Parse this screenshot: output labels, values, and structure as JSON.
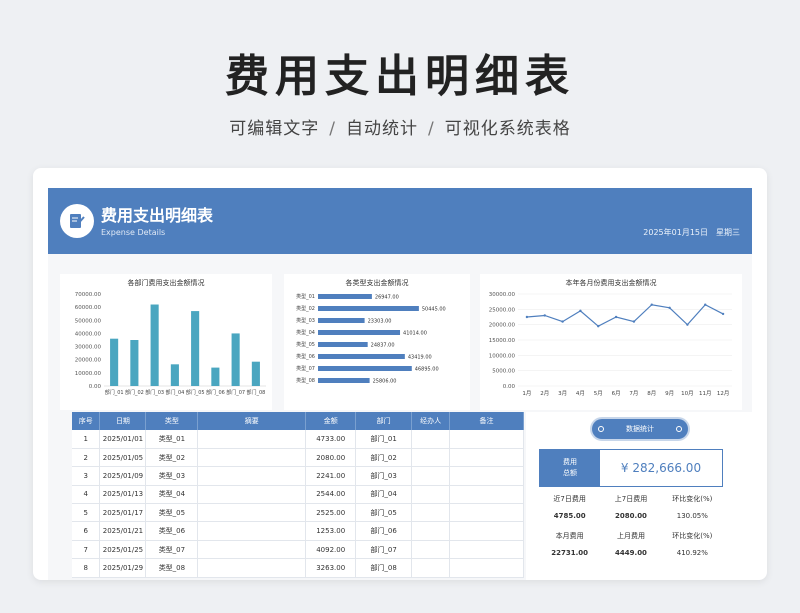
{
  "hero": {
    "title": "费用支出明细表",
    "sub1": "可编辑文字",
    "sub2": "自动统计",
    "sub3": "可视化系统表格",
    "sep": "/"
  },
  "banner": {
    "title": "费用支出明细表",
    "subtitle": "Expense Details",
    "date": "2025年01月15日",
    "weekday": "星期三"
  },
  "colors": {
    "accent": "#4f7fbe",
    "bar1": "#4aa6c0",
    "bar2": "#4f7fbe"
  },
  "charts": [
    {
      "type": "bar",
      "title": "各部门费用支出金额情况",
      "categories": [
        "部门_01",
        "部门_02",
        "部门_03",
        "部门_04",
        "部门_05",
        "部门_06",
        "部门_07",
        "部门_08"
      ],
      "values": [
        36000,
        35000,
        62000,
        16500,
        57000,
        14000,
        40000,
        18500
      ],
      "ylim": [
        0,
        70000
      ],
      "yticks": [
        "70000.00",
        "60000.00",
        "50000.00",
        "40000.00",
        "30000.00",
        "20000.00",
        "10000.00",
        "0.00"
      ]
    },
    {
      "type": "bar-horizontal",
      "title": "各类型支出金额情况",
      "categories": [
        "类型_01",
        "类型_02",
        "类型_03",
        "类型_04",
        "类型_05",
        "类型_06",
        "类型_07",
        "类型_08"
      ],
      "values": [
        26947.0,
        50445.0,
        23303.0,
        41014.0,
        24837.0,
        43419.0,
        46895.0,
        25806.0
      ],
      "labels": [
        "26947.00",
        "50445.00",
        "23303.00",
        "41014.00",
        "24837.00",
        "43419.00",
        "46895.00",
        "25806.00"
      ],
      "xlim": [
        0,
        60000
      ]
    },
    {
      "type": "line",
      "title": "本年各月份费用支出金额情况",
      "categories": [
        "1月",
        "2月",
        "3月",
        "4月",
        "5月",
        "6月",
        "7月",
        "8月",
        "9月",
        "10月",
        "11月",
        "12月"
      ],
      "values": [
        22500,
        23000,
        21000,
        24500,
        19500,
        22500,
        21000,
        26500,
        25500,
        20000,
        26500,
        23500
      ],
      "ylim": [
        0,
        30000
      ],
      "yticks": [
        "30000.00",
        "25000.00",
        "20000.00",
        "15000.00",
        "10000.00",
        "5000.00",
        "0.00"
      ]
    }
  ],
  "table": {
    "headers": [
      "序号",
      "日期",
      "类型",
      "摘要",
      "金额",
      "部门",
      "经办人",
      "备注"
    ],
    "rows": [
      [
        "1",
        "2025/01/01",
        "类型_01",
        "",
        "4733.00",
        "部门_01",
        "",
        ""
      ],
      [
        "2",
        "2025/01/05",
        "类型_02",
        "",
        "2080.00",
        "部门_02",
        "",
        ""
      ],
      [
        "3",
        "2025/01/09",
        "类型_03",
        "",
        "2241.00",
        "部门_03",
        "",
        ""
      ],
      [
        "4",
        "2025/01/13",
        "类型_04",
        "",
        "2544.00",
        "部门_04",
        "",
        ""
      ],
      [
        "5",
        "2025/01/17",
        "类型_05",
        "",
        "2525.00",
        "部门_05",
        "",
        ""
      ],
      [
        "6",
        "2025/01/21",
        "类型_06",
        "",
        "1253.00",
        "部门_06",
        "",
        ""
      ],
      [
        "7",
        "2025/01/25",
        "类型_07",
        "",
        "4092.00",
        "部门_07",
        "",
        ""
      ],
      [
        "8",
        "2025/01/29",
        "类型_08",
        "",
        "3263.00",
        "部门_08",
        "",
        ""
      ]
    ]
  },
  "stats": {
    "button": "数据统计",
    "total_label_1": "费用",
    "total_label_2": "总额",
    "total_value": "¥ 282,666.00",
    "row1_labels": [
      "近7日费用",
      "上7日费用",
      "环比变化(%)"
    ],
    "row1_values": [
      "4785.00",
      "2080.00",
      "130.05%"
    ],
    "row2_labels": [
      "本月费用",
      "上月费用",
      "环比变化(%)"
    ],
    "row2_values": [
      "22731.00",
      "4449.00",
      "410.92%"
    ]
  }
}
